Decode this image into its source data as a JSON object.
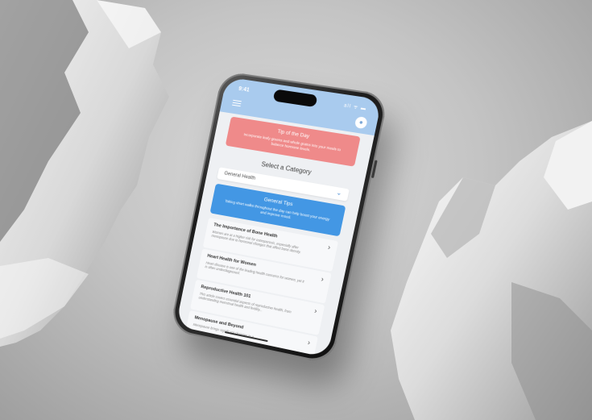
{
  "status_bar": {
    "time": "9:41",
    "icons": "all ᯤ ▬"
  },
  "tip_of_day": {
    "title": "Tip of the Day",
    "text": "Incorporate leafy greens and whole grains into your meals to balance hormone levels."
  },
  "category": {
    "title": "Select a Category",
    "selected": "General Health"
  },
  "general_tips": {
    "title": "General Tips",
    "text": "Taking short walks throughout the day can help boost your energy and improve mood."
  },
  "articles": [
    {
      "title": "The Importance of Bone Health",
      "desc": "Women are at a higher risk for osteoporosis, especially after menopause due to hormonal changes that affect bone density."
    },
    {
      "title": "Heart Health for Women",
      "desc": "Heart disease is one of the leading health concerns for women, yet it is often underdiagnosed."
    },
    {
      "title": "Reproductive Health 101",
      "desc": "This article covers essential aspects of reproductive health, from understanding menstrual health and fertility..."
    },
    {
      "title": "Menopause and Beyond",
      "desc": "Menopause brings significant changes to a..."
    }
  ],
  "icons": {
    "menu": "hamburger-icon",
    "profile": "user-icon",
    "chevron_down": "chevron-down-icon",
    "chevron_right": "chevron-right-icon"
  },
  "colors": {
    "header": "#a9cbee",
    "tip_card": "#ef8a8a",
    "tips_card": "#4397e4",
    "background": "#eef0f3"
  }
}
